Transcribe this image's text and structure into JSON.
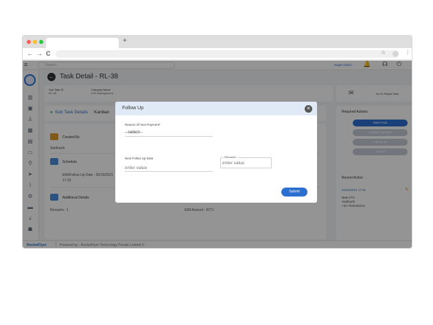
{
  "browser": {
    "new_tab_label": "+",
    "back_glyph": "←",
    "forward_glyph": "→",
    "reload_glyph": "C",
    "star_glyph": "☆",
    "menu_glyph": "⋮"
  },
  "topbar": {
    "search_placeholder": "Search",
    "user_name": "Super Admin"
  },
  "page": {
    "title": "Task Detail - RL-38",
    "meta": [
      {
        "label": "Sub Task ID",
        "value": "RL-38"
      },
      {
        "label": "Category Name",
        "value": "EVA Management"
      }
    ],
    "goto_label": "Go To Parent Task",
    "tabs": [
      "Sub Task Details",
      "Kanban"
    ]
  },
  "content": {
    "created_by_title": "Created By",
    "created_by_value": "Siddharth",
    "schedule_title": "Schedule",
    "emi_followup": "EMI/Follow Up Date : 05/15/2021",
    "emi_time": "17:33",
    "additional_title": "Additional Details",
    "remarks": "Remarks : 1",
    "emi_amount": "EMI Amount : 6271"
  },
  "right_panel": {
    "required_title": "Required Actions",
    "actions": [
      "Mark Paid",
      "Update Payment",
      "Follow Up",
      "Cancel"
    ],
    "recent_title": "Recent Action",
    "recent_date": "04/15/2021 17:31",
    "recent_status": "New CTA",
    "recent_user": "Siddharth",
    "recent_phone": "+91-7030381631"
  },
  "footer": {
    "logo": "RocketFlyer",
    "text": "Powered by : RocketFlyer Technology Private Limited ©"
  },
  "modal": {
    "title": "Follow Up",
    "reason_label": "Reason Of Non Payment*",
    "reason_value": "--select--",
    "followup_label": "Next Follow Up Date",
    "followup_placeholder": "enter value",
    "remarks_label": "Remarks*",
    "remarks_placeholder": "enter value",
    "submit_label": "Submit"
  },
  "colors": {
    "accent": "#2c6fcf",
    "success": "#3cae58",
    "modal_header": "#dfeaf6"
  }
}
